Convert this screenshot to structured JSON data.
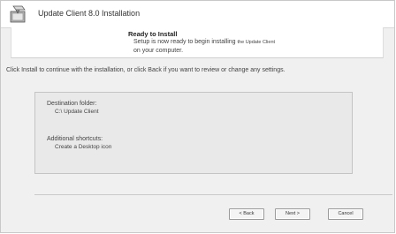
{
  "window": {
    "title": "Update Client 8.0 Installation",
    "icon": "installer-icon"
  },
  "header": {
    "title": "Ready to Install",
    "subtitle_line1": "Setup is now ready to begin installing",
    "subtitle_app": "the Update Client",
    "subtitle_line2": "on your computer."
  },
  "instruction": "Click Install to continue with the installation, or click Back if you want to review or change any settings.",
  "summary": {
    "destination_label": "Destination folder:",
    "destination_value": "C:\\ Update Client",
    "shortcuts_label": "Additional shortcuts:",
    "shortcuts_value": "Create a Desktop icon"
  },
  "buttons": {
    "back": "< Back",
    "next": "Next >",
    "cancel": "Cancel"
  }
}
